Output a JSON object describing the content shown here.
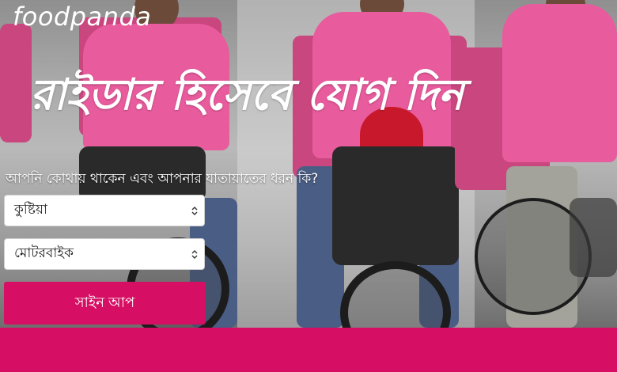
{
  "brand": {
    "logo_text": "foodpanda",
    "accent_color": "#d70f64"
  },
  "hero": {
    "headline": "রাইডার হিসেবে যোগ দিন",
    "question": "আপনি কোথায় থাকেন এবং আপনার যাতায়াতের ধরন কি?"
  },
  "form": {
    "city_select": {
      "selected": "কুষ্টিয়া"
    },
    "vehicle_select": {
      "selected": "মোটরবাইক"
    },
    "signup_label": "সাইন আপ"
  },
  "icons": {
    "select_arrow": "chevron-down-icon"
  }
}
